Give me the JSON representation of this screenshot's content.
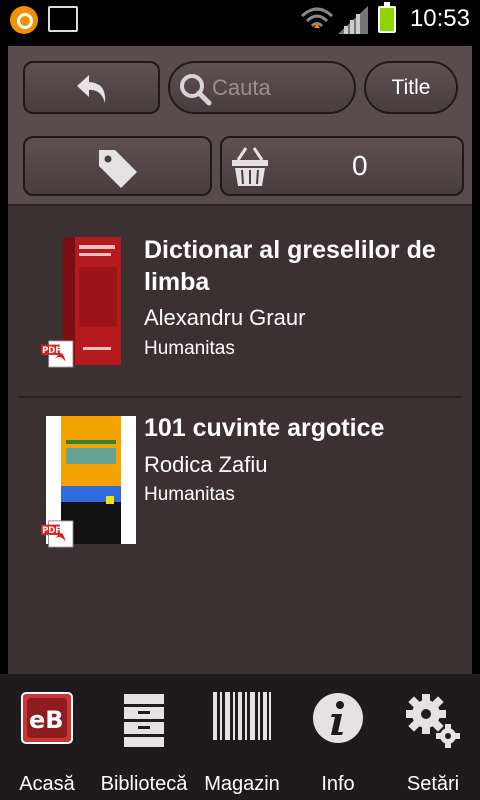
{
  "status_bar": {
    "time": "10:53"
  },
  "toolbar": {
    "search_placeholder": "Cauta",
    "sort_label": "Title",
    "cart_count": "0"
  },
  "books": [
    {
      "title": "Dictionar al greselilor de limba",
      "author": "Alexandru Graur",
      "publisher": "Humanitas",
      "format": "PDF"
    },
    {
      "title": "101 cuvinte argotice",
      "author": "Rodica Zafiu",
      "publisher": "Humanitas",
      "format": "PDF"
    }
  ],
  "nav": {
    "items": [
      {
        "label": "Acasă",
        "icon": "ebooks-logo-icon"
      },
      {
        "label": "Bibliotecă",
        "icon": "cabinet-icon"
      },
      {
        "label": "Magazin",
        "icon": "barcode-icon"
      },
      {
        "label": "Info",
        "icon": "info-icon"
      },
      {
        "label": "Setări",
        "icon": "gear-icon"
      }
    ]
  }
}
